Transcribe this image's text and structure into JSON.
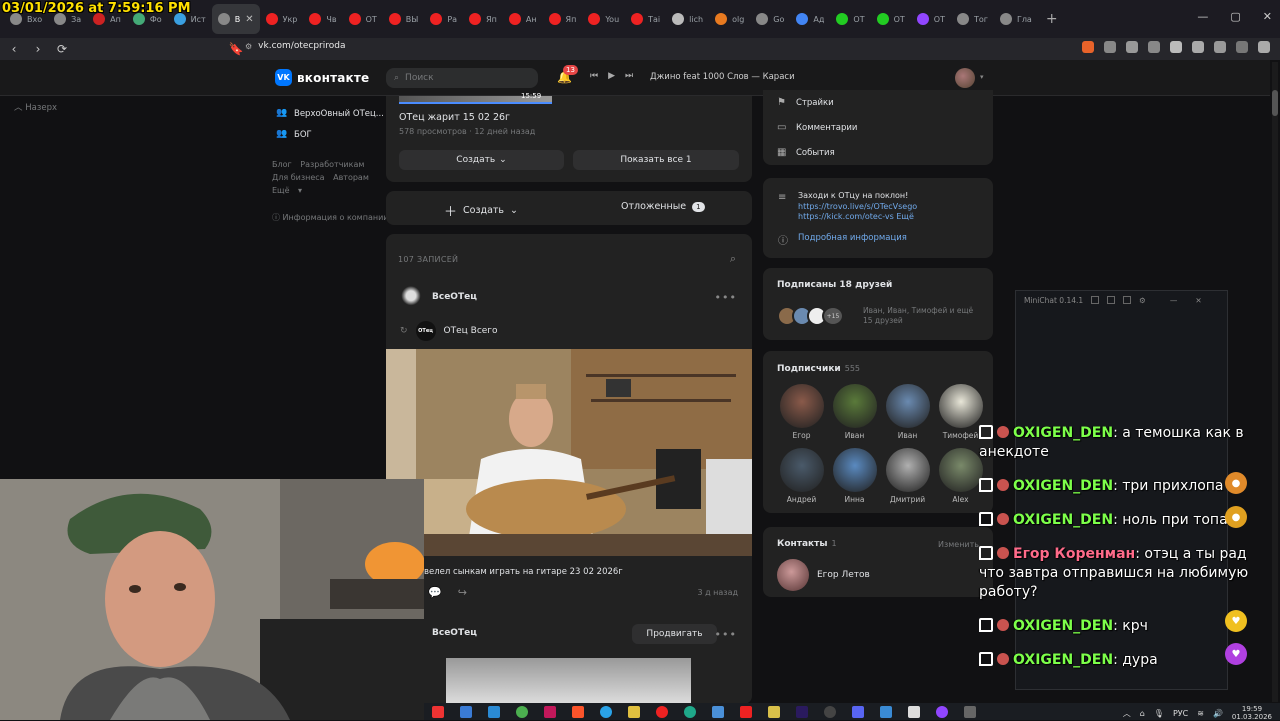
{
  "overlay": {
    "timestamp": "03/01/2026 at 7:59:16 PM"
  },
  "browser": {
    "tabs": [
      {
        "label": "Вхо",
        "color": "#888"
      },
      {
        "label": "За",
        "color": "#888"
      },
      {
        "label": "Ап",
        "color": "#c22"
      },
      {
        "label": "Фо",
        "color": "#4a7"
      },
      {
        "label": "Ист",
        "color": "#3a9fe0"
      },
      {
        "label": "В",
        "color": "#888"
      },
      {
        "label": "Укр",
        "color": "#e22"
      },
      {
        "label": "Чв",
        "color": "#e22"
      },
      {
        "label": "ОТ",
        "color": "#e22"
      },
      {
        "label": "ВЫ",
        "color": "#e22"
      },
      {
        "label": "Ра",
        "color": "#e22"
      },
      {
        "label": "Яп",
        "color": "#e22"
      },
      {
        "label": "Ан",
        "color": "#e22"
      },
      {
        "label": "Яп",
        "color": "#e22"
      },
      {
        "label": "You",
        "color": "#e22"
      },
      {
        "label": "Таі",
        "color": "#e22"
      },
      {
        "label": "lich",
        "color": "#bbb"
      },
      {
        "label": "olg",
        "color": "#e87a20"
      },
      {
        "label": "Go",
        "color": "#888"
      },
      {
        "label": "Ад",
        "color": "#4285f4"
      },
      {
        "label": "ОТ",
        "color": "#2c2"
      },
      {
        "label": "ОТ",
        "color": "#2c2"
      },
      {
        "label": "ОТ",
        "color": "#9146ff"
      },
      {
        "label": "Тог",
        "color": "#888"
      },
      {
        "label": "Гла",
        "color": "#888"
      }
    ],
    "url": "vk.com/otecpriroda"
  },
  "vk": {
    "logo": "вконтакте",
    "search_placeholder": "Поиск",
    "notif_count": "13",
    "track": "Джино feat 1000 Слов — Караси",
    "back_label": "Назерх",
    "left_nav": [
      "ВерхоОвный ОТец...",
      "БОГ"
    ],
    "footer_links": [
      "Блог",
      "Разработчикам",
      "Для бизнеса",
      "Авторам",
      "Ещё"
    ],
    "info_link": "Информация о компании"
  },
  "video_card": {
    "duration": "15:59",
    "title": "ОТец жарит 15 02 26г",
    "meta": "578 просмотров · 12 дней назад",
    "create_label": "Создать",
    "show_all_label": "Показать все 1"
  },
  "create_bar": {
    "create_label": "Создать",
    "deferred_label": "Отложенные",
    "deferred_count": "1"
  },
  "wall": {
    "count_label": "107 ЗАПИСЕЙ",
    "author": "ВсеОТец",
    "repost_author": "ОТец Всего",
    "repost_avatar_text": "ОТец",
    "caption": "велел сынкам играть на гитаре 23 02 2026г",
    "ago": "3 д назад",
    "post2_author": "ВсеОТец",
    "promo_label": "Продвигать"
  },
  "right": {
    "menu": [
      {
        "label": "Страйки",
        "icon": "flag-icon"
      },
      {
        "label": "Комментарии",
        "icon": "comment-icon"
      },
      {
        "label": "События",
        "icon": "calendar-icon"
      }
    ],
    "about_text": "Заходи к ОТцу на поклон!",
    "about_link1": "https://trovo.live/s/OTecVsego",
    "about_link2": "https://kick.com/otec-vs",
    "about_more": "Ещё",
    "details_label": "Подробная информация",
    "friends_sub_header": "Подписаны 18 друзей",
    "friends_sub_line1": "Иван, Иван, Тимофей и ещё",
    "friends_sub_line2": "15 друзей",
    "friends_more": "+15",
    "followers_header": "Подписчики",
    "followers_count": "555",
    "followers": [
      {
        "name": "Егор",
        "color": "#8a5a4a"
      },
      {
        "name": "Иван",
        "color": "#5a7a3a"
      },
      {
        "name": "Иван",
        "color": "#6a8ab0"
      },
      {
        "name": "Тимофей",
        "color": "#e8e6d8"
      },
      {
        "name": "Андрей",
        "color": "#4a5a6a"
      },
      {
        "name": "Инна",
        "color": "#5a8ac0"
      },
      {
        "name": "Дмитрий",
        "color": "#b0b0b0"
      },
      {
        "name": "Alex",
        "color": "#7a8a6a"
      }
    ],
    "contacts_header": "Контакты",
    "contacts_count": "1",
    "contacts_edit": "Изменить",
    "contact_name": "Егор Летов"
  },
  "minichat": {
    "title": "MiniChat 0.14.1"
  },
  "chat": [
    {
      "nick": "OXIGEN_DEN",
      "text": ": а темошка как в анекдоте",
      "color": "#7dff4a"
    },
    {
      "nick": "OXIGEN_DEN",
      "text": ": три прихлопа",
      "color": "#7dff4a"
    },
    {
      "nick": "OXIGEN_DEN",
      "text": ": ноль при топа",
      "color": "#7dff4a"
    },
    {
      "nick": "Егор Коренман",
      "text": ": отэц а ты рад что завтра отправишся на любимую работу?",
      "color": "#ff6b8a"
    },
    {
      "nick": "OXIGEN_DEN",
      "text": ": крч",
      "color": "#7dff4a"
    },
    {
      "nick": "OXIGEN_DEN",
      "text": ": дура",
      "color": "#7dff4a"
    }
  ],
  "taskbar": {
    "lang": "РУС",
    "time": "19:59",
    "date": "01.03.2026"
  }
}
